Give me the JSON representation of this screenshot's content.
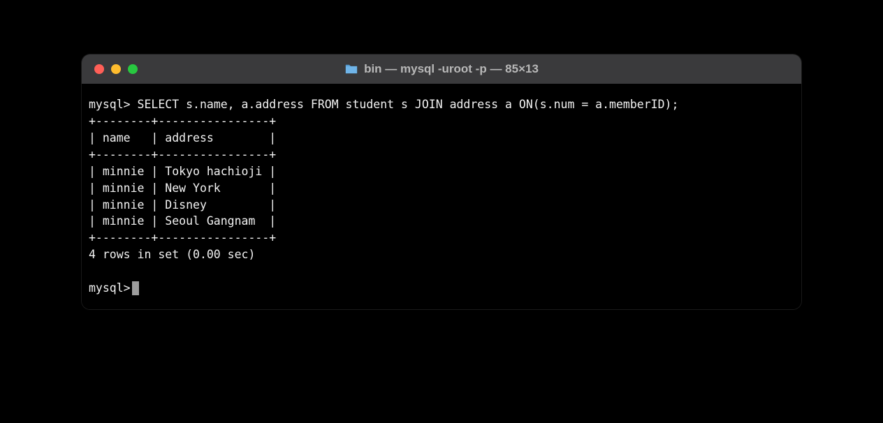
{
  "window": {
    "title": "bin — mysql -uroot -p — 85×13",
    "folder_icon": "folder"
  },
  "terminal": {
    "prompt": "mysql>",
    "query": "SELECT s.name, a.address FROM student s JOIN address a ON(s.num = a.memberID);",
    "table": {
      "border": "+--------+----------------+",
      "header": "| name   | address        |",
      "rows": [
        "| minnie | Tokyo hachioji |",
        "| minnie | New York       |",
        "| minnie | Disney         |",
        "| minnie | Seoul Gangnam  |"
      ]
    },
    "result_status": "4 rows in set (0.00 sec)",
    "columns": [
      "name",
      "address"
    ],
    "data": [
      {
        "name": "minnie",
        "address": "Tokyo hachioji"
      },
      {
        "name": "minnie",
        "address": "New York"
      },
      {
        "name": "minnie",
        "address": "Disney"
      },
      {
        "name": "minnie",
        "address": "Seoul Gangnam"
      }
    ]
  }
}
